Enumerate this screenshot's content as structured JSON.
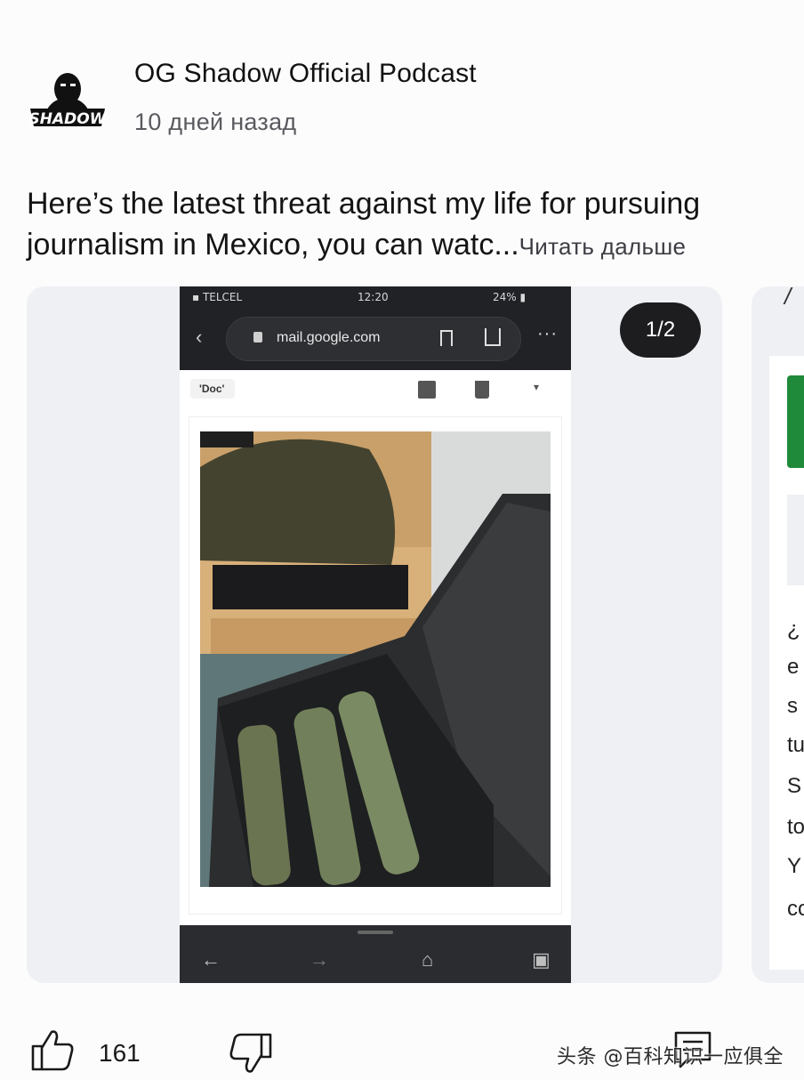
{
  "channel": {
    "name": "OG Shadow Official Podcast",
    "posted": "10 дней назад",
    "avatar_text": "SHADOW"
  },
  "post": {
    "text": "Here’s the latest threat against my life for pursuing journalism in Mexico, you can watc...",
    "read_more": "Читать дальше"
  },
  "carousel": {
    "counter": "1/2",
    "next_peek_letters": [
      "¿",
      "e",
      "s",
      "tu",
      "S",
      "to",
      "Y",
      "co"
    ]
  },
  "screenshot": {
    "carrier": "TELCEL",
    "time": "12:20",
    "battery": "24%",
    "url": "mail.google.com",
    "label": "'Doc'",
    "nav_back": "←",
    "nav_forward": "→"
  },
  "actions": {
    "likes": "161"
  },
  "watermark": "头条 @百科知识一应俱全",
  "colors": {
    "accent_green": "#1f8a3a",
    "counter_bg": "#1d1d1f"
  }
}
